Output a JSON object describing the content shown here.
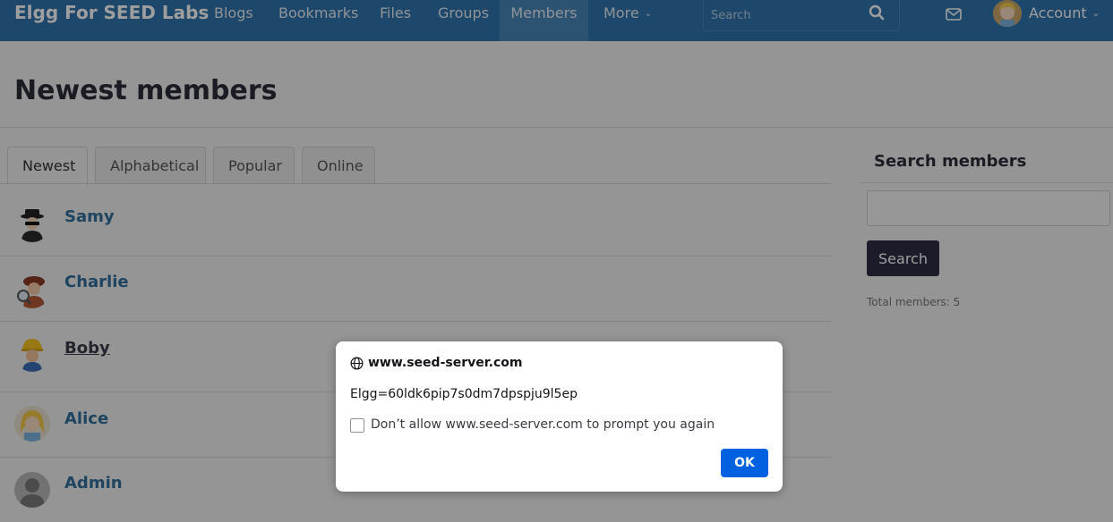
{
  "header": {
    "site_name": "Elgg For SEED Labs",
    "nav": [
      "Blogs",
      "Bookmarks",
      "Files",
      "Groups",
      "Members",
      "More"
    ],
    "active_nav": "Members",
    "search_placeholder": "Search",
    "account_label": "Account",
    "colors": {
      "bar": "#2f74ad",
      "active": "#4a86b8"
    }
  },
  "page": {
    "title": "Newest members",
    "tabs": [
      "Newest",
      "Alphabetical",
      "Popular",
      "Online"
    ],
    "selected_tab": "Newest",
    "members": [
      {
        "name": "Samy",
        "avatar": "spy-avatar"
      },
      {
        "name": "Charlie",
        "avatar": "detective-avatar"
      },
      {
        "name": "Boby",
        "avatar": "builder-avatar"
      },
      {
        "name": "Alice",
        "avatar": "alice-avatar"
      },
      {
        "name": "Admin",
        "avatar": "default-avatar"
      }
    ]
  },
  "sidebar": {
    "title": "Search members",
    "button_label": "Search",
    "total": "Total members: 5"
  },
  "dialog": {
    "host": "www.seed-server.com",
    "message": "Elgg=60ldk6pip7s0dm7dpspju9l5ep",
    "checkbox_label": "Don’t allow www.seed-server.com to prompt you again",
    "ok_label": "OK"
  }
}
